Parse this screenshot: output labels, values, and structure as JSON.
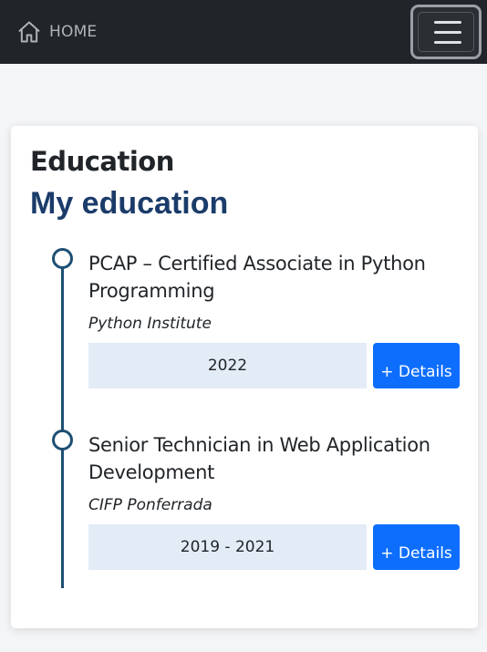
{
  "navbar": {
    "brand_label": "HOME",
    "brand_icon": "home-icon",
    "toggler_icon": "hamburger-menu-icon"
  },
  "section": {
    "title": "Education",
    "subtitle": "My education"
  },
  "entries": [
    {
      "title": "PCAP – Certified Associate in Python Programming",
      "institution": "Python Institute",
      "date": "2022",
      "button_label": "+ Details"
    },
    {
      "title": "Senior Technician in Web Application Development",
      "institution": "CIFP Ponferrada",
      "date": "2019 - 2021",
      "button_label": "+ Details"
    }
  ],
  "colors": {
    "navbar_bg": "#212529",
    "heading_blue": "#1b3c6a",
    "timeline": "#1d4f73",
    "date_bg": "#e3ebf7",
    "button_bg": "#0d6efd"
  }
}
